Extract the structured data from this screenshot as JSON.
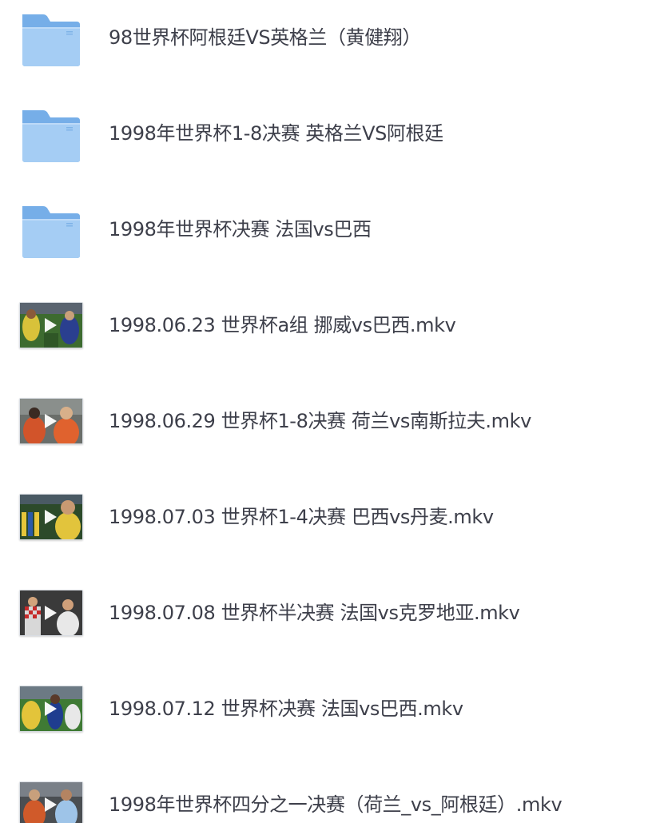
{
  "file_list": {
    "items": [
      {
        "type": "folder",
        "icon": "folder-icon",
        "name": "98世界杯阿根廷VS英格兰（黄健翔）"
      },
      {
        "type": "folder",
        "icon": "folder-icon",
        "name": "1998年世界杯1-8决赛 英格兰VS阿根廷"
      },
      {
        "type": "folder",
        "icon": "folder-icon",
        "name": "1998年世界杯决赛 法国vs巴西"
      },
      {
        "type": "video",
        "icon": "video-thumbnail",
        "name": "1998.06.23 世界杯a组 挪威vs巴西.mkv"
      },
      {
        "type": "video",
        "icon": "video-thumbnail",
        "name": "1998.06.29 世界杯1-8决赛 荷兰vs南斯拉夫.mkv"
      },
      {
        "type": "video",
        "icon": "video-thumbnail",
        "name": "1998.07.03 世界杯1-4决赛 巴西vs丹麦.mkv"
      },
      {
        "type": "video",
        "icon": "video-thumbnail",
        "name": "1998.07.08 世界杯半决赛 法国vs克罗地亚.mkv"
      },
      {
        "type": "video",
        "icon": "video-thumbnail",
        "name": "1998.07.12 世界杯决赛 法国vs巴西.mkv"
      },
      {
        "type": "video",
        "icon": "video-thumbnail",
        "name": "1998年世界杯四分之一决赛（荷兰_vs_阿根廷）.mkv"
      }
    ]
  },
  "colors": {
    "folder_body": "#9cc8f4",
    "folder_tab": "#76aee8",
    "text": "#3d3f4a",
    "play_icon": "#ffffff"
  }
}
